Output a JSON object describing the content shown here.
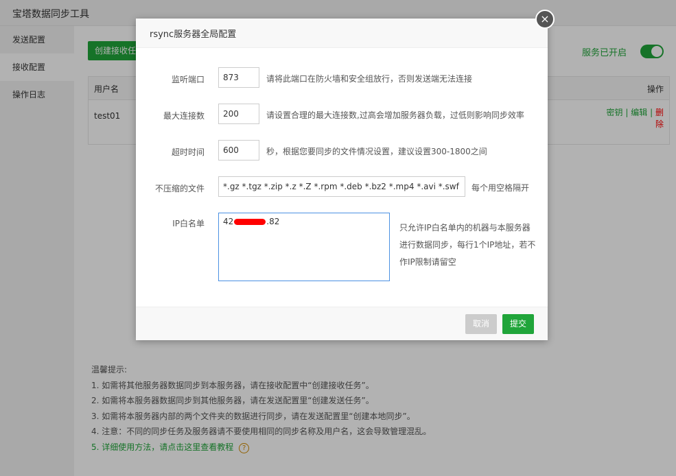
{
  "app": {
    "title": "宝塔数据同步工具"
  },
  "sidebar": {
    "items": [
      {
        "label": "发送配置",
        "active": false
      },
      {
        "label": "接收配置",
        "active": true
      },
      {
        "label": "操作日志",
        "active": false
      }
    ]
  },
  "main": {
    "create_button": "创建接收任务",
    "service_label": "服务已开启",
    "service_on": true,
    "table": {
      "headers": {
        "user": "用户名",
        "ops": "操作"
      },
      "rows": [
        {
          "user": "test01",
          "op_key": "密钥",
          "sep": "|",
          "op_edit": "编辑",
          "op_delete": "删除"
        }
      ]
    },
    "tips": {
      "title": "温馨提示:",
      "lines": [
        "1. 如需将其他服务器数据同步到本服务器，请在接收配置中“创建接收任务”。",
        "2. 如需将本服务器数据同步到其他服务器，请在发送配置里“创建发送任务”。",
        "3. 如需将本服务器内部的两个文件夹的数据进行同步，请在发送配置里“创建本地同步”。",
        "4. 注意：不同的同步任务及服务器请不要使用相同的同步名称及用户名，这会导致管理混乱。"
      ],
      "link": "5. 详细使用方法，请点击这里查看教程",
      "help_icon": "?"
    }
  },
  "modal": {
    "title": "rsync服务器全局配置",
    "close_icon": "×",
    "fields": {
      "port": {
        "label": "监听端口",
        "value": "873",
        "note": "请将此端口在防火墙和安全组放行，否则发送端无法连接"
      },
      "max_conn": {
        "label": "最大连接数",
        "value": "200",
        "note": "请设置合理的最大连接数,过高会增加服务器负载，过低则影响同步效率"
      },
      "timeout": {
        "label": "超时时间",
        "value": "600",
        "note": "秒，根据您要同步的文件情况设置，建议设置300-1800之间"
      },
      "no_compress": {
        "label": "不压缩的文件",
        "value": "*.gz *.tgz *.zip *.z *.Z *.rpm *.deb *.bz2 *.mp4 *.avi *.swf *.rar",
        "note": "每个用空格隔开"
      },
      "ip_whitelist": {
        "label": "IP白名单",
        "value_prefix": "42",
        "value_suffix": ".82",
        "note": "只允许IP白名单内的机器与本服务器进行数据同步，每行1个IP地址，若不作IP限制请留空"
      }
    },
    "cancel_label": "取消",
    "submit_label": "提交"
  },
  "colors": {
    "accent": "#20a53a",
    "danger": "#ff0000",
    "input_focus": "#4a90e2"
  }
}
